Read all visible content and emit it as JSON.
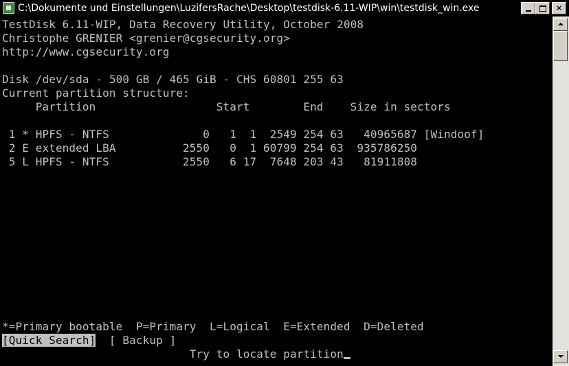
{
  "window": {
    "title": "C:\\Dokumente und Einstellungen\\LuzifersRache\\Desktop\\testdisk-6.11-WIP\\win\\testdisk_win.exe",
    "icon": "console-app-icon",
    "controls": [
      "minimize",
      "maximize",
      "close"
    ]
  },
  "console": {
    "header": [
      "TestDisk 6.11-WIP, Data Recovery Utility, October 2008",
      "Christophe GRENIER <grenier@cgsecurity.org>",
      "http://www.cgsecurity.org"
    ],
    "disk_info": "Disk /dev/sda - 500 GB / 465 GiB - CHS 60801 255 63",
    "structure_title": "Current partition structure:",
    "columns_header": "     Partition                  Start        End    Size in sectors",
    "rows": [
      " 1 * HPFS - NTFS              0   1  1  2549 254 63   40965687 [Windoof]",
      " 2 E extended LBA          2550   0  1 60799 254 63  935786250",
      " 5 L HPFS - NTFS           2550   6 17  7648 203 43   81911808"
    ],
    "legend": "*=Primary bootable  P=Primary  L=Logical  E=Extended  D=Deleted",
    "actions": {
      "quick_search": "[Quick Search]",
      "backup": "[ Backup ]"
    },
    "hint_prefix": "                            ",
    "hint": "Try to locate partition"
  },
  "colors": {
    "console_bg": "#000000",
    "console_fg": "#c0c0c0",
    "highlight_bg": "#c0c0c0",
    "highlight_fg": "#000000",
    "titlebar_bg": "#000000",
    "titlebar_fg": "#ffffff"
  }
}
